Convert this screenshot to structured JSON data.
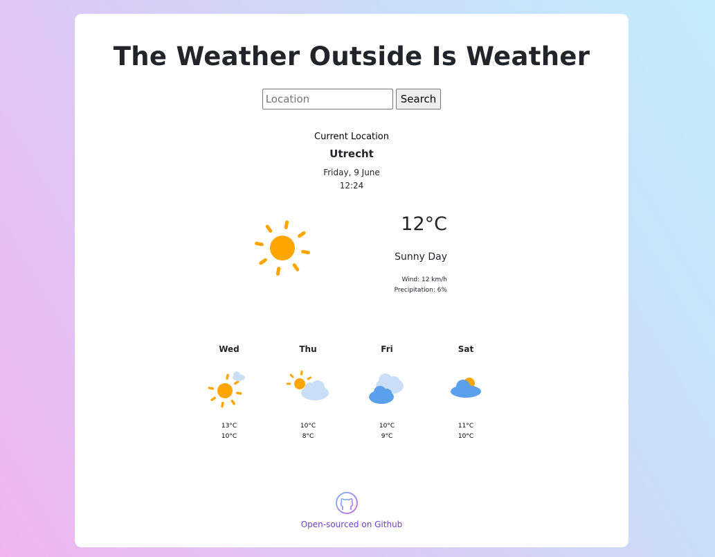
{
  "app": {
    "title": "The Weather Outside Is Weather"
  },
  "search": {
    "placeholder": "Location",
    "value": "",
    "button_label": "Search"
  },
  "current": {
    "label": "Current Location",
    "city": "Utrecht",
    "date": "Friday, 9 June",
    "time": "12:24",
    "icon": "sun-icon",
    "temperature": "12°C",
    "condition": "Sunny Day",
    "wind": "Wind: 12 km/h",
    "precipitation": "Precipitation: 6%"
  },
  "forecast": [
    {
      "day": "Wed",
      "icon": "sun-small-cloud-icon",
      "high": "13°C",
      "low": "10°C"
    },
    {
      "day": "Thu",
      "icon": "sun-cloud-icon",
      "high": "10°C",
      "low": "8°C"
    },
    {
      "day": "Fri",
      "icon": "cloudy-icon",
      "high": "10°C",
      "low": "9°C"
    },
    {
      "day": "Sat",
      "icon": "cloud-sun-behind-icon",
      "high": "11°C",
      "low": "10°C"
    }
  ],
  "footer": {
    "icon": "github-icon",
    "link_label": "Open-sourced on Github"
  },
  "colors": {
    "sun": "#ffa500",
    "cloud_dark": "#5aa0ea",
    "cloud_light": "#cadff7",
    "link": "#6f42c1"
  }
}
